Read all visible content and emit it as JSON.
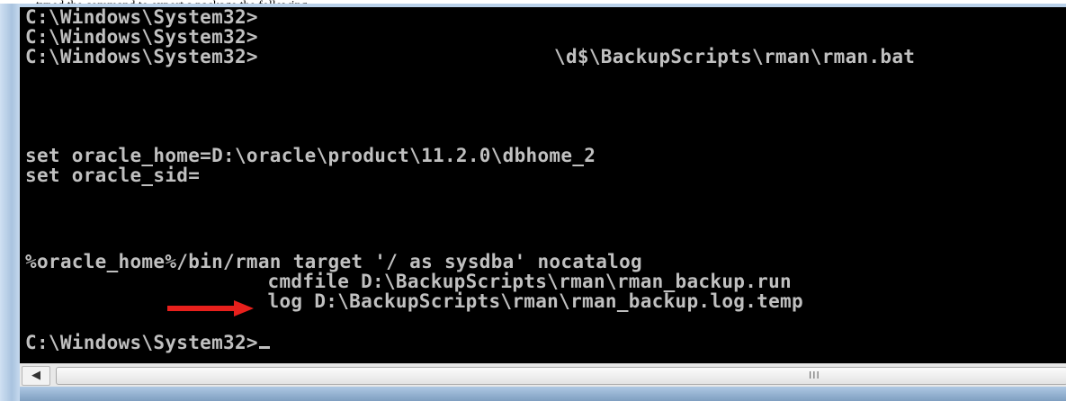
{
  "caption": {
    "text": "typed the command to export a package the following"
  },
  "console": {
    "lines": [
      "C:\\Windows\\System32>",
      "C:\\Windows\\System32>",
      "C:\\Windows\\System32>",
      "\\d$\\BackupScripts\\rman\\rman.bat",
      "set oracle_home=D:\\oracle\\product\\11.2.0\\dbhome_2",
      "set oracle_sid=",
      "%oracle_home%/bin/rman target '/ as sysdba' nocatalog",
      "        cmdfile D:\\BackupScripts\\rman\\rman_backup.run",
      "        log D:\\BackupScripts\\rman\\rman_backup.log.temp",
      "C:\\Windows\\System32>"
    ],
    "text_color": "#c0c0c0",
    "background": "#000000"
  },
  "annotation": {
    "arrow_color": "#e8201c",
    "icon": "red-arrow-icon"
  },
  "scrollbar": {
    "left_arrow": "◀",
    "grip": "III"
  }
}
